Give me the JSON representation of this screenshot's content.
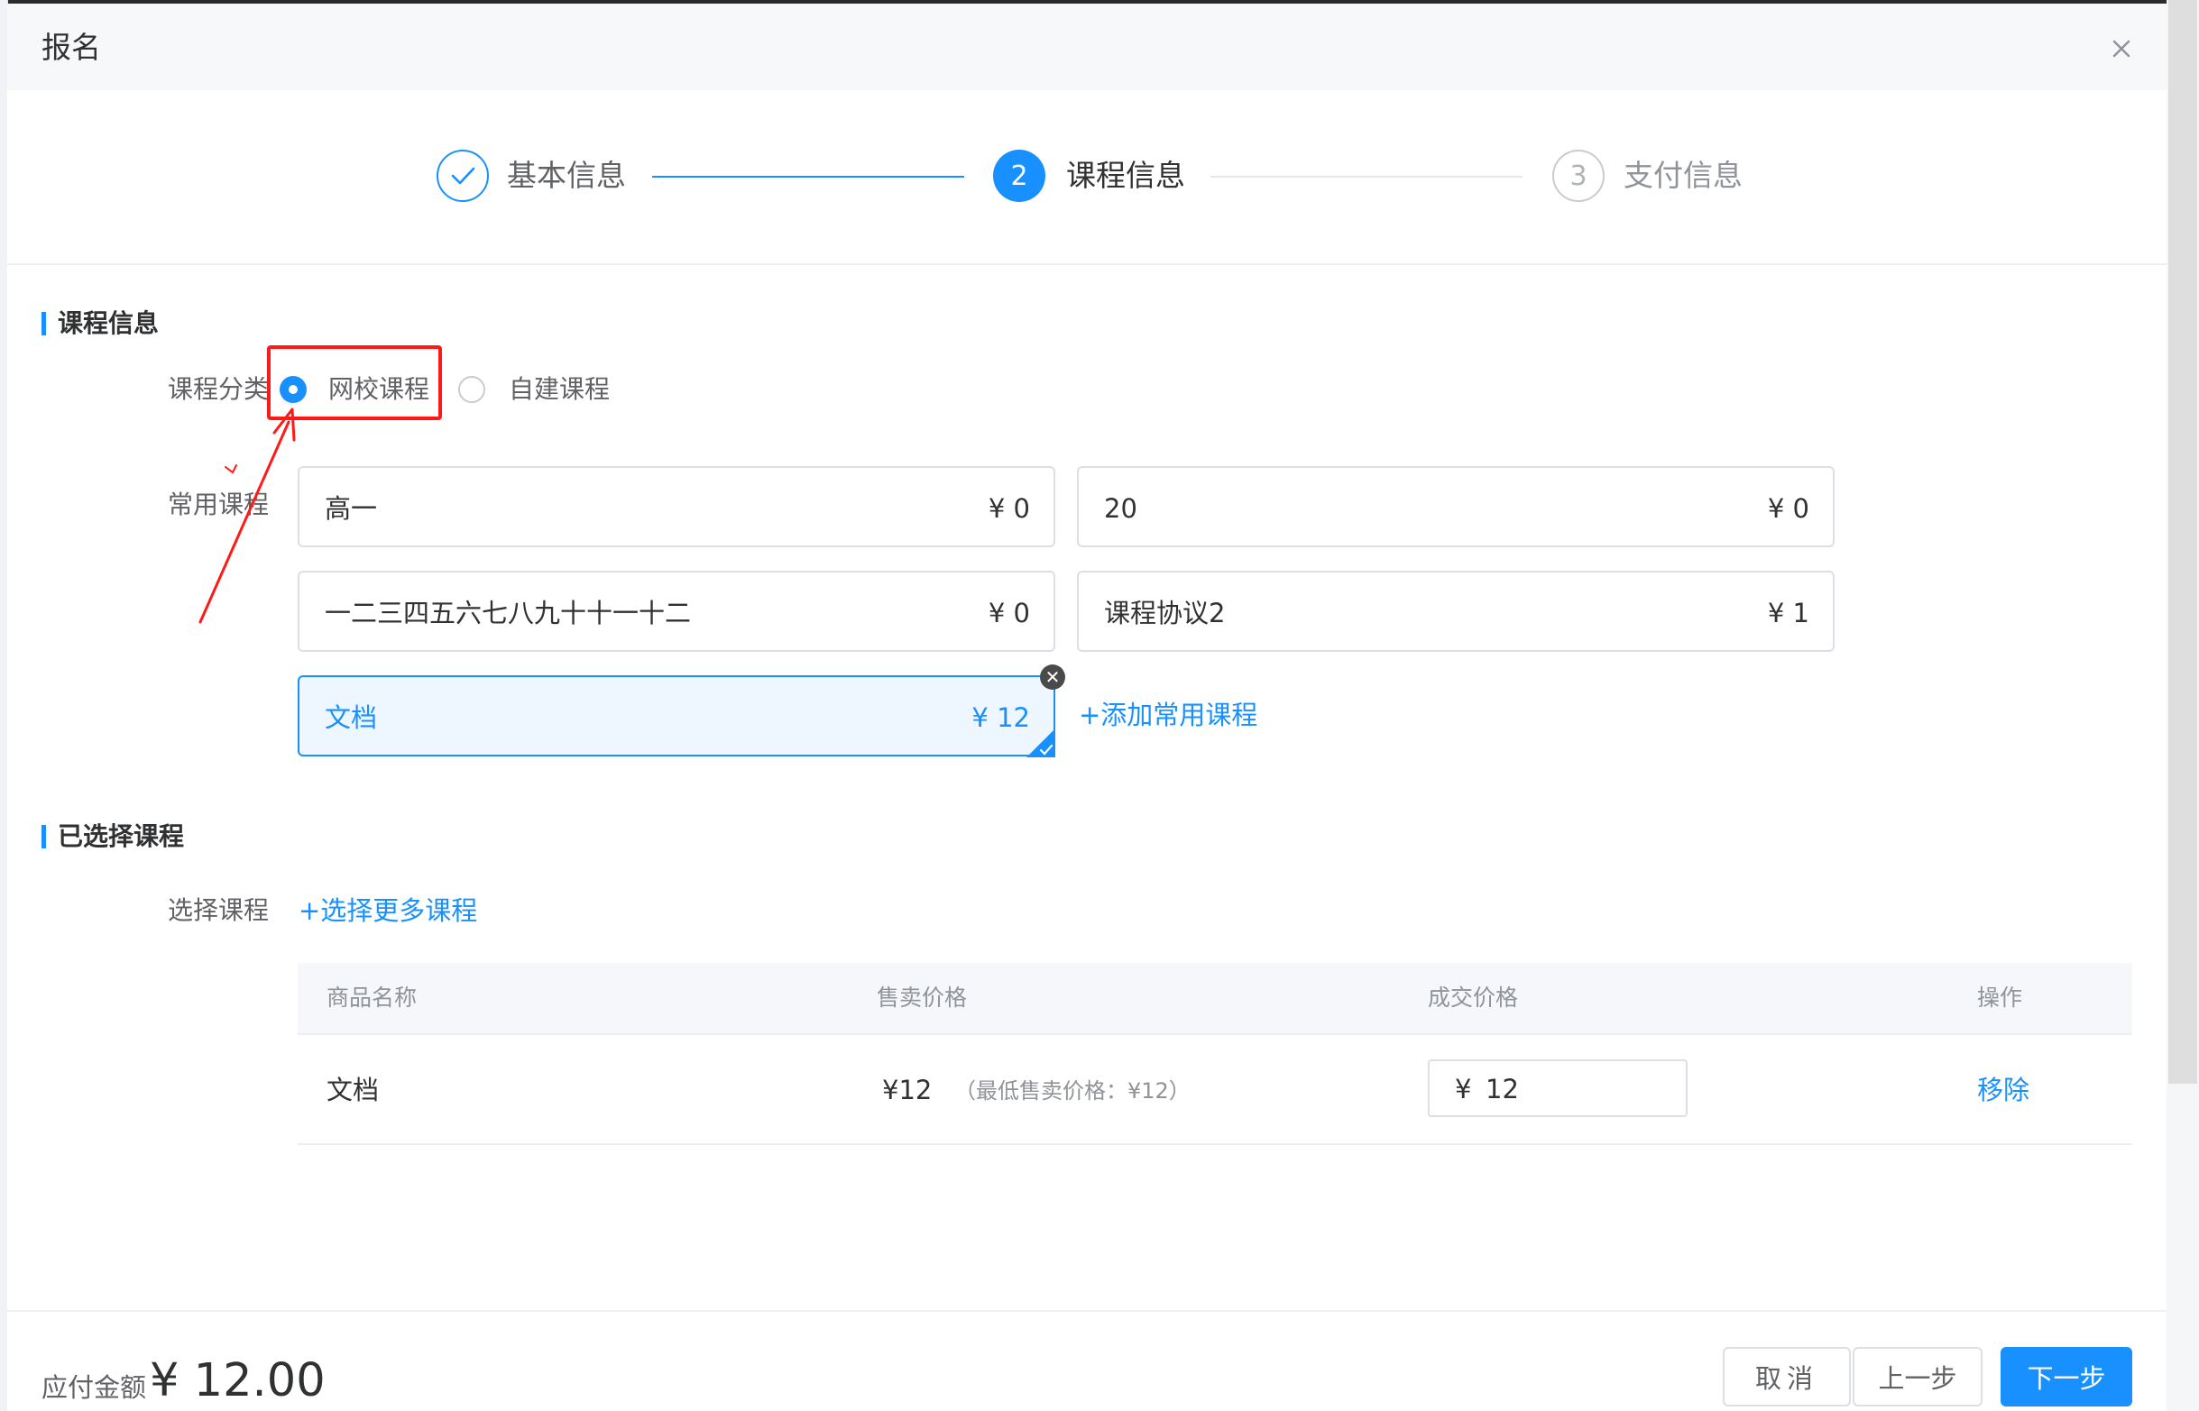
{
  "dialog": {
    "title": "报名",
    "close_icon": "close-icon"
  },
  "steps": [
    {
      "label": "基本信息",
      "marker": "",
      "status": "done",
      "icon": "check-icon"
    },
    {
      "label": "课程信息",
      "marker": "2",
      "status": "active"
    },
    {
      "label": "支付信息",
      "marker": "3",
      "status": "pending"
    }
  ],
  "course_info": {
    "section_title": "课程信息",
    "category_label": "课程分类",
    "category_options": [
      {
        "label": "网校课程",
        "selected": true
      },
      {
        "label": "自建课程",
        "selected": false
      }
    ],
    "common_label": "常用课程",
    "common_courses": [
      {
        "name": "高一",
        "price": "¥ 0",
        "selected": false
      },
      {
        "name": "20",
        "price": "¥ 0",
        "selected": false
      },
      {
        "name": "一二三四五六七八九十十一十二",
        "price": "¥ 0",
        "selected": false
      },
      {
        "name": "课程协议2",
        "price": "¥ 1",
        "selected": false
      },
      {
        "name": "文档",
        "price": "¥ 12",
        "selected": true
      }
    ],
    "add_common_link": "+添加常用课程"
  },
  "selected_courses": {
    "section_title": "已选择课程",
    "select_label": "选择课程",
    "select_more_link": "+选择更多课程",
    "columns": [
      "商品名称",
      "售卖价格",
      "成交价格",
      "操作"
    ],
    "rows": [
      {
        "name": "文档",
        "sale_price": "¥12",
        "sale_note": "（最低售卖价格：¥12）",
        "deal_currency": "¥",
        "deal_value": "12",
        "action": "移除"
      }
    ]
  },
  "footer": {
    "payable_label": "应付金额",
    "payable_amount": "¥ 12.00",
    "cancel_label": "取消",
    "prev_label": "上一步",
    "next_label": "下一步"
  },
  "colors": {
    "primary": "#1890ff",
    "annotation": "#ff1a1a",
    "text": "#303133",
    "muted": "#909399"
  }
}
